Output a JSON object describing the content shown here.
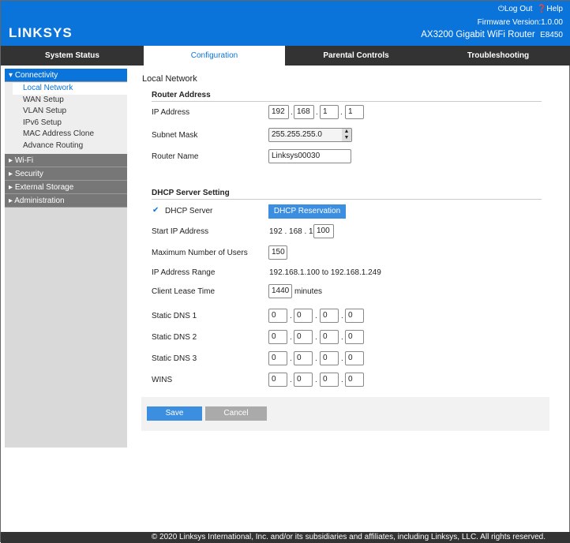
{
  "header": {
    "brand": "LINKSYS",
    "logout": "Log Out",
    "help": "Help",
    "firmware": "Firmware Version:1.0.00",
    "model": "AX3200 Gigabit WiFi Router",
    "model_code": "E8450",
    "color": "#0a74da"
  },
  "nav": {
    "tabs": [
      {
        "label": "System Status"
      },
      {
        "label": "Configuration",
        "active": true
      },
      {
        "label": "Parental Controls"
      },
      {
        "label": "Troubleshooting"
      }
    ]
  },
  "sidebar": {
    "connectivity": "Connectivity",
    "items": [
      "Local Network",
      "WAN Setup",
      "VLAN Setup",
      "IPv6 Setup",
      "MAC Address Clone",
      "Advance Routing"
    ],
    "groups": [
      "Wi-Fi",
      "Security",
      "External Storage",
      "Administration"
    ]
  },
  "main": {
    "title": "Local Network",
    "router": {
      "heading": "Router Address",
      "ip_label": "IP Address",
      "ip": [
        "192",
        "168",
        "1",
        "1"
      ],
      "subnet_label": "Subnet Mask",
      "subnet": "255.255.255.0",
      "name_label": "Router Name",
      "name": "Linksys00030"
    },
    "dhcp": {
      "heading": "DHCP Server Setting",
      "server_label": "DHCP Server",
      "server_checked": true,
      "reservation": "DHCP Reservation",
      "start_label": "Start IP Address",
      "start_prefix": "192 . 168 . 1.",
      "start_last": "100",
      "max_label": "Maximum Number of Users",
      "max": "150",
      "range_label": "IP Address Range",
      "range": "192.168.1.100 to 192.168.1.249",
      "lease_label": "Client Lease Time",
      "lease": "1440",
      "lease_unit": "minutes",
      "dns": [
        {
          "label": "Static DNS 1",
          "v": [
            "0",
            "0",
            "0",
            "0"
          ]
        },
        {
          "label": "Static DNS 2",
          "v": [
            "0",
            "0",
            "0",
            "0"
          ]
        },
        {
          "label": "Static DNS 3",
          "v": [
            "0",
            "0",
            "0",
            "0"
          ]
        },
        {
          "label": "WINS",
          "v": [
            "0",
            "0",
            "0",
            "0"
          ]
        }
      ]
    },
    "save": "Save",
    "cancel": "Cancel"
  },
  "footer": "© 2020 Linksys International, Inc. and/or its subsidiaries and affiliates, including Linksys, LLC. All rights reserved."
}
